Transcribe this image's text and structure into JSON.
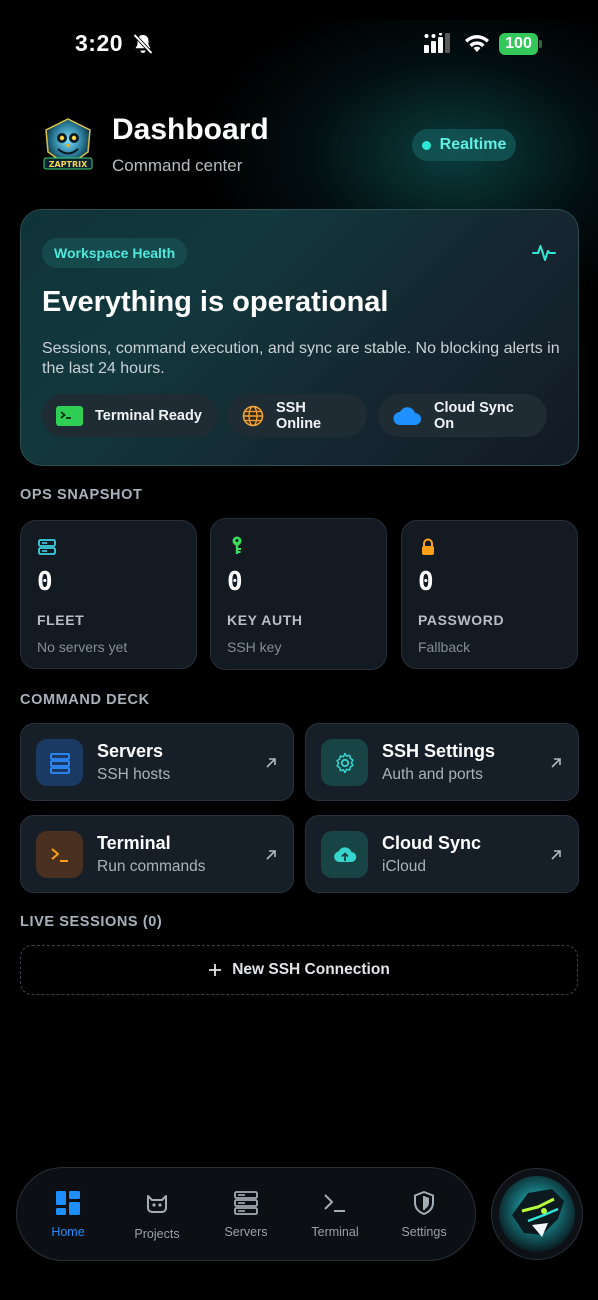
{
  "status_bar": {
    "time": "3:20",
    "battery": "100"
  },
  "header": {
    "title": "Dashboard",
    "subtitle": "Command center",
    "realtime_label": "Realtime",
    "logo_text": "ZAPTRIX"
  },
  "health": {
    "badge": "Workspace Health",
    "title": "Everything is operational",
    "description": "Sessions, command execution, and sync are stable. No blocking alerts in the last 24 hours.",
    "chips": [
      {
        "label": "Terminal Ready",
        "icon": "terminal-icon"
      },
      {
        "label": "SSH Online",
        "icon": "globe-icon"
      },
      {
        "label": "Cloud Sync On",
        "icon": "cloud-icon"
      }
    ]
  },
  "ops_snapshot": {
    "heading": "OPS SNAPSHOT",
    "cards": [
      {
        "value": "0",
        "label": "FLEET",
        "sub": "No servers yet",
        "icon": "server-icon",
        "color": "#3fd0e0"
      },
      {
        "value": "0",
        "label": "KEY AUTH",
        "sub": "SSH key",
        "icon": "key-icon",
        "color": "#3ddc5a"
      },
      {
        "value": "0",
        "label": "PASSWORD",
        "sub": "Fallback",
        "icon": "lock-icon",
        "color": "#ff9f1a"
      }
    ]
  },
  "command_deck": {
    "heading": "COMMAND DECK",
    "items": [
      {
        "title": "Servers",
        "subtitle": "SSH hosts",
        "icon": "server-icon"
      },
      {
        "title": "SSH Settings",
        "subtitle": "Auth and ports",
        "icon": "gear-icon"
      },
      {
        "title": "Terminal",
        "subtitle": "Run commands",
        "icon": "terminal-icon"
      },
      {
        "title": "Cloud Sync",
        "subtitle": "iCloud",
        "icon": "cloud-upload-icon"
      }
    ]
  },
  "live_sessions": {
    "heading": "LIVE SESSIONS (0)",
    "new_connection_label": "New SSH Connection"
  },
  "tab_bar": {
    "tabs": [
      {
        "label": "Home",
        "icon": "home-grid-icon",
        "active": true
      },
      {
        "label": "Projects",
        "icon": "github-cat-icon",
        "active": false
      },
      {
        "label": "Servers",
        "icon": "server-stack-icon",
        "active": false
      },
      {
        "label": "Terminal",
        "icon": "terminal-prompt-icon",
        "active": false
      },
      {
        "label": "Settings",
        "icon": "shield-icon",
        "active": false
      }
    ]
  },
  "colors": {
    "accent": "#1f8fff",
    "teal": "#2ee6d6",
    "background": "#000000"
  }
}
